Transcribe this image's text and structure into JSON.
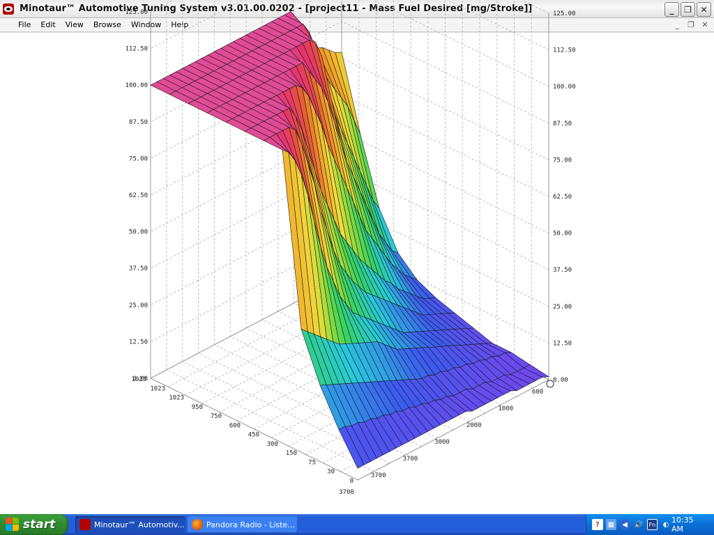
{
  "window": {
    "title": "Minotaur™ Automotive Tuning System  v3.01.00.0202 - [project11 - Mass Fuel Desired [mg/Stroke]]",
    "minimize": "_",
    "maximize": "❐",
    "close": "✕"
  },
  "menu": {
    "items": [
      "File",
      "Edit",
      "View",
      "Browse",
      "Window",
      "Help"
    ],
    "mdi_minimize": "_",
    "mdi_restore": "❐",
    "mdi_close": "✕"
  },
  "colors": {
    "accent": "#245edb",
    "surface_top": "#e0409a",
    "surface_low": "#6a4cf0"
  },
  "chart_data": {
    "type": "surface3d",
    "title": "Mass Fuel Desired [mg/Stroke]",
    "z_ticks": [
      "125.00",
      "112.50",
      "100.00",
      "87.50",
      "75.00",
      "62.50",
      "50.00",
      "37.50",
      "25.00",
      "12.50",
      "0.00"
    ],
    "left_axis_ticks": [
      "1023",
      "1023",
      "1023",
      "950",
      "750",
      "600",
      "450",
      "300",
      "150",
      "75",
      "30",
      "0"
    ],
    "right_axis_ticks": [
      "600",
      "1000",
      "2000",
      "3000",
      "3700",
      "3700",
      "3700"
    ],
    "zlim": [
      0,
      125
    ],
    "grid": true,
    "rows": [
      [
        100,
        100,
        100,
        100,
        100,
        100,
        100,
        100,
        100,
        100,
        100,
        100,
        100,
        100,
        100,
        100,
        100,
        100,
        100,
        100,
        100,
        100,
        100,
        90,
        87,
        85,
        83,
        82,
        80,
        78,
        77
      ],
      [
        100,
        100,
        100,
        100,
        100,
        100,
        100,
        100,
        100,
        100,
        100,
        100,
        100,
        100,
        100,
        100,
        100,
        100,
        100,
        100,
        100,
        100,
        96,
        85,
        80,
        76,
        72,
        68,
        64,
        58,
        52
      ],
      [
        100,
        100,
        100,
        100,
        100,
        100,
        100,
        100,
        100,
        100,
        100,
        100,
        100,
        100,
        100,
        100,
        100,
        100,
        100,
        100,
        98,
        92,
        80,
        70,
        64,
        58,
        52,
        46,
        40,
        34,
        30
      ],
      [
        100,
        100,
        100,
        100,
        100,
        100,
        100,
        100,
        100,
        100,
        100,
        100,
        100,
        100,
        100,
        100,
        96,
        92,
        88,
        82,
        74,
        66,
        58,
        52,
        46,
        40,
        34,
        28,
        24,
        20,
        18
      ],
      [
        100,
        100,
        100,
        100,
        100,
        100,
        100,
        100,
        100,
        100,
        100,
        100,
        98,
        94,
        88,
        82,
        74,
        68,
        62,
        56,
        50,
        44,
        38,
        34,
        30,
        26,
        22,
        19,
        16,
        14,
        12
      ],
      [
        100,
        100,
        100,
        100,
        100,
        100,
        100,
        100,
        96,
        90,
        82,
        74,
        66,
        60,
        54,
        48,
        44,
        40,
        36,
        33,
        30,
        27,
        24,
        22,
        19,
        17,
        15,
        13,
        11,
        10,
        9
      ],
      [
        100,
        100,
        100,
        100,
        100,
        98,
        92,
        84,
        76,
        66,
        58,
        50,
        44,
        40,
        36,
        33,
        30,
        28,
        26,
        24,
        22,
        20,
        18,
        16,
        14,
        12,
        11,
        10,
        9,
        8,
        7
      ],
      [
        100,
        98,
        94,
        88,
        80,
        70,
        60,
        52,
        46,
        40,
        36,
        32,
        30,
        28,
        26,
        24,
        22,
        20,
        18,
        16,
        15,
        14,
        13,
        12,
        11,
        10,
        9,
        8,
        7,
        6,
        5
      ],
      [
        42,
        40,
        38,
        36,
        34,
        32,
        30,
        29,
        28,
        27,
        26,
        25,
        24,
        22,
        20,
        18,
        17,
        16,
        15,
        14,
        13,
        12,
        11,
        10,
        9,
        8,
        7,
        6,
        5,
        4,
        3
      ],
      [
        26,
        25,
        24,
        23,
        22,
        21,
        20,
        19,
        18,
        17,
        16,
        15,
        14,
        13,
        12,
        11,
        10,
        10,
        9,
        9,
        8,
        8,
        7,
        7,
        6,
        6,
        5,
        5,
        4,
        4,
        3
      ],
      [
        14,
        14,
        13,
        13,
        12,
        12,
        11,
        11,
        10,
        10,
        9,
        9,
        8,
        8,
        7,
        7,
        6,
        6,
        5,
        5,
        5,
        4,
        4,
        4,
        3,
        3,
        3,
        2,
        2,
        2,
        2
      ],
      [
        4,
        4,
        4,
        4,
        4,
        4,
        4,
        4,
        4,
        4,
        4,
        4,
        4,
        4,
        4,
        4,
        4,
        4,
        3,
        3,
        3,
        3,
        3,
        3,
        3,
        2,
        2,
        2,
        2,
        2,
        1
      ]
    ]
  },
  "taskbar": {
    "start_label": "start",
    "tasks": [
      "Minotaur™ Automotiv...",
      "Pandora Radio - Liste..."
    ],
    "clock": "10:35 AM"
  }
}
